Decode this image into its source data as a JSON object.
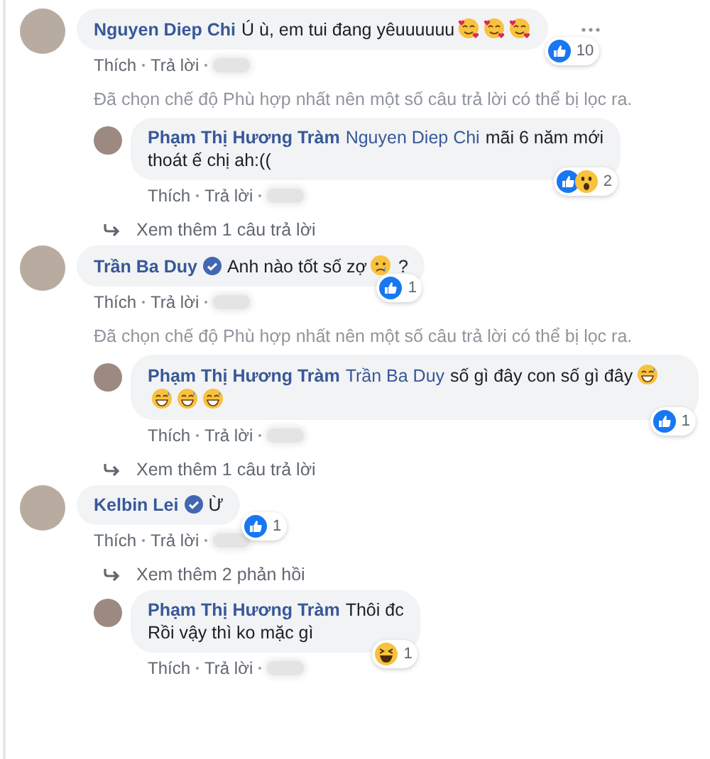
{
  "thread": [
    {
      "kind": "comment",
      "author": "Nguyen Diep Chi",
      "verified": false,
      "lines": [
        "Ú ù, em tui đang yêuuuuuu"
      ],
      "emojis": [
        {
          "kind": "hearts"
        },
        {
          "kind": "hearts"
        },
        {
          "kind": "hearts"
        }
      ],
      "reactions": [
        {
          "kind": "like"
        }
      ],
      "count": "10",
      "menu": true,
      "actions": [
        "Thích",
        "Trả lời"
      ]
    },
    {
      "kind": "note",
      "text": "Đã chọn chế độ Phù hợp nhất nên một số câu trả lời có thể bị lọc ra."
    },
    {
      "kind": "reply",
      "author": "Phạm Thị Hương Tràm",
      "verified": false,
      "mention": "Nguyen Diep Chi",
      "lines": [
        "mãi 6 năm mới",
        "thoát ế chị ah:(("
      ],
      "reactions": [
        {
          "kind": "like"
        },
        {
          "kind": "wow"
        }
      ],
      "count": "2",
      "menu": false,
      "actions": [
        "Thích",
        "Trả lời"
      ]
    },
    {
      "kind": "more",
      "text": "Xem thêm 1 câu trả lời"
    },
    {
      "kind": "comment",
      "author": "Trần Ba Duy",
      "verified": true,
      "lines": [
        "Anh nào tốt số zợ"
      ],
      "emojis": [
        {
          "kind": "sad"
        }
      ],
      "tail": "?",
      "reactions": [
        {
          "kind": "like"
        }
      ],
      "count": "1",
      "menu": false,
      "actions": [
        "Thích",
        "Trả lời"
      ]
    },
    {
      "kind": "note",
      "text": "Đã chọn chế độ Phù hợp nhất nên một số câu trả lời có thể bị lọc ra."
    },
    {
      "kind": "reply",
      "author": "Phạm Thị Hương Tràm",
      "verified": false,
      "mention": "Trần Ba Duy",
      "lines": [
        "số gì đây con số gì đây"
      ],
      "emojis": [
        {
          "kind": "grin"
        },
        {
          "kind": "grin"
        },
        {
          "kind": "grin"
        },
        {
          "kind": "grin"
        }
      ],
      "reactions": [
        {
          "kind": "like"
        }
      ],
      "count": "1",
      "menu": false,
      "actions": [
        "Thích",
        "Trả lời"
      ]
    },
    {
      "kind": "more",
      "text": "Xem thêm 1 câu trả lời"
    },
    {
      "kind": "comment",
      "author": "Kelbin Lei",
      "verified": true,
      "lines": [
        "Ừ"
      ],
      "reactions": [
        {
          "kind": "like"
        }
      ],
      "count": "1",
      "menu": false,
      "actions": [
        "Thích",
        "Trả lời"
      ]
    },
    {
      "kind": "more",
      "text": "Xem thêm 2 phản hồi"
    },
    {
      "kind": "reply",
      "author": "Phạm Thị Hương Tràm",
      "verified": false,
      "lines": [
        "Thôi đc",
        "Rồi vậy thì ko mặc gì"
      ],
      "reactions": [
        {
          "kind": "haha"
        }
      ],
      "count": "1",
      "menu": false,
      "actions": [
        "Thích",
        "Trả lời"
      ]
    }
  ]
}
